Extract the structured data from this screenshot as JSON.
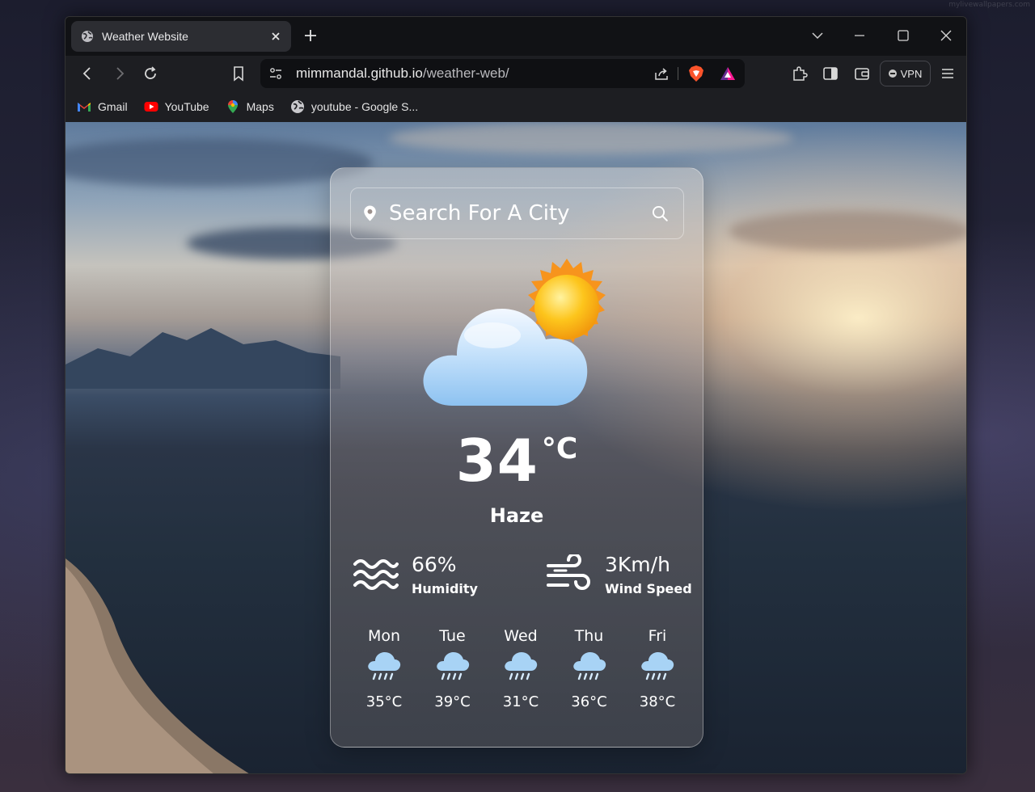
{
  "desktop": {
    "watermark": "mylivewallpapers.com"
  },
  "browser": {
    "tab": {
      "title": "Weather Website",
      "favicon": "globe-icon"
    },
    "url": {
      "host": "mimmandal.github.io",
      "path": "/weather-web/"
    },
    "vpn_label": "VPN",
    "bookmarks": [
      {
        "label": "Gmail",
        "icon": "gmail-icon"
      },
      {
        "label": "YouTube",
        "icon": "youtube-icon"
      },
      {
        "label": "Maps",
        "icon": "maps-icon"
      },
      {
        "label": "youtube - Google S...",
        "icon": "globe-icon"
      }
    ]
  },
  "weather": {
    "search": {
      "placeholder": "Search For A City"
    },
    "current": {
      "temperature": "34",
      "unit": "°C",
      "condition": "Haze",
      "icon": "partly-cloudy-icon"
    },
    "humidity": {
      "value": "66%",
      "label": "Humidity",
      "icon": "waves-icon"
    },
    "wind": {
      "value": "3Km/h",
      "label": "Wind Speed",
      "icon": "wind-icon"
    },
    "forecast": [
      {
        "day": "Mon",
        "temp": "35°C",
        "icon": "rain-cloud-icon"
      },
      {
        "day": "Tue",
        "temp": "39°C",
        "icon": "rain-cloud-icon"
      },
      {
        "day": "Wed",
        "temp": "31°C",
        "icon": "rain-cloud-icon"
      },
      {
        "day": "Thu",
        "temp": "36°C",
        "icon": "rain-cloud-icon"
      },
      {
        "day": "Fri",
        "temp": "38°C",
        "icon": "rain-cloud-icon"
      }
    ]
  },
  "colors": {
    "browser_frame": "#111215",
    "toolbar": "#1d1e22",
    "urlbar": "#0f1013",
    "brave_orange": "#fb542b",
    "sun": "#fdb913",
    "cloud": "#a8d3f5"
  }
}
